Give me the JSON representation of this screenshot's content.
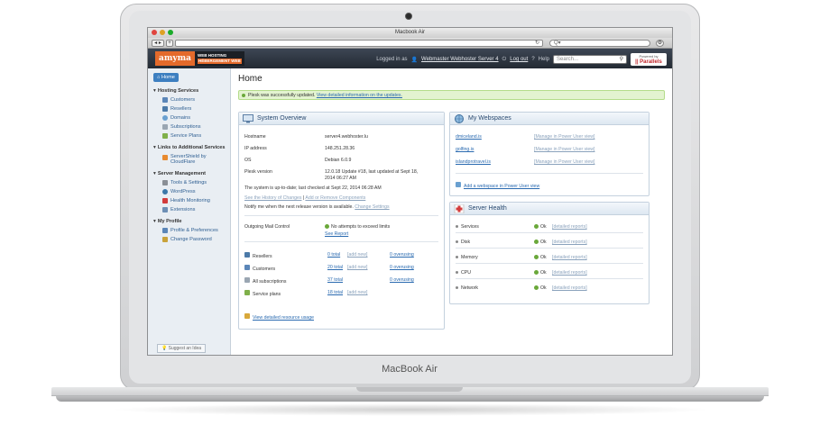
{
  "device": {
    "brand_label": "MacBook Air"
  },
  "browser": {
    "window_title": "Macbook Air",
    "url_value": "",
    "search_placeholder": "Q▾"
  },
  "header": {
    "logo_name": "amyma",
    "logo_sub_1": "WEB HOSTING",
    "logo_sub_2": "HÉBERGEMENT WEB",
    "logged_in_label": "Logged in as",
    "user_name": "Webmaster Webhoster Server 4",
    "logout_label": "Log out",
    "help_label": "Help",
    "search_placeholder": "Search...",
    "powered_by": "Powered by",
    "parallels": "|| Parallels"
  },
  "sidebar": {
    "home_label": "Home",
    "sections": [
      {
        "title": "Hosting Services",
        "items": [
          "Customers",
          "Resellers",
          "Domains",
          "Subscriptions",
          "Service Plans"
        ]
      },
      {
        "title": "Links to Additional Services",
        "items": [
          "ServerShield by CloudFlare"
        ]
      },
      {
        "title": "Server Management",
        "items": [
          "Tools & Settings",
          "WordPress",
          "Health Monitoring",
          "Extensions"
        ]
      },
      {
        "title": "My Profile",
        "items": [
          "Profile & Preferences",
          "Change Password"
        ]
      }
    ],
    "suggest_label": "Suggest an Idea"
  },
  "main": {
    "page_title": "Home",
    "success_message": "Plesk was successfully updated.",
    "success_link": "View detailed information on the updates.",
    "system_overview": {
      "title": "System Overview",
      "hostname_label": "Hostname",
      "hostname_value": "server4.webhoster.lu",
      "ip_label": "IP address",
      "ip_value": "148.251.28.36",
      "os_label": "OS",
      "os_value": "Debian 6.0.9",
      "plesk_label": "Plesk version",
      "plesk_value_1": "12.0.18 Update #18, last updated at Sept 18,",
      "plesk_value_2": "2014 06:27 AM",
      "uptodate_text": "The system is up-to-date; last checked at Sept 22, 2014 06:28 AM",
      "history_link": "See the History of Changes",
      "separator": "|",
      "components_link": "Add or Remove Components",
      "notify_text": "Notify me when the next release version is available.",
      "change_settings_link": "Change Settings",
      "mail_label": "Outgoing Mail Control",
      "mail_status": "No attempts to exceed limits",
      "see_report_link": "See Report",
      "stats": [
        {
          "label": "Resellers",
          "total": "0 total",
          "add": "[add new]",
          "over": "0 overusing"
        },
        {
          "label": "Customers",
          "total": "20 total",
          "add": "[add new]",
          "over": "0 overusing"
        },
        {
          "label": "All subscriptions",
          "total": "37 total",
          "add": "",
          "over": "0 overusing"
        },
        {
          "label": "Service plans",
          "total": "18 total",
          "add": "[add new]",
          "over": ""
        }
      ],
      "resource_link": "View detailed resource usage"
    },
    "webspaces": {
      "title": "My Webspaces",
      "items": [
        {
          "domain": "dmiceland.is",
          "manage": "[Manage in Power User view]"
        },
        {
          "domain": "golfing.is",
          "manage": "[Manage in Power User view]"
        },
        {
          "domain": "islandprotravel.is",
          "manage": "[Manage in Power User view]"
        }
      ],
      "add_link": "Add a webspace in Power User view"
    },
    "health": {
      "title": "Server Health",
      "items": [
        {
          "name": "Services",
          "status": "Ok",
          "link": "[detailed reports]"
        },
        {
          "name": "Disk",
          "status": "Ok",
          "link": "[detailed reports]"
        },
        {
          "name": "Memory",
          "status": "Ok",
          "link": "[detailed reports]"
        },
        {
          "name": "CPU",
          "status": "Ok",
          "link": "[detailed reports]"
        },
        {
          "name": "Network",
          "status": "Ok",
          "link": "[detailed reports]"
        }
      ]
    }
  }
}
